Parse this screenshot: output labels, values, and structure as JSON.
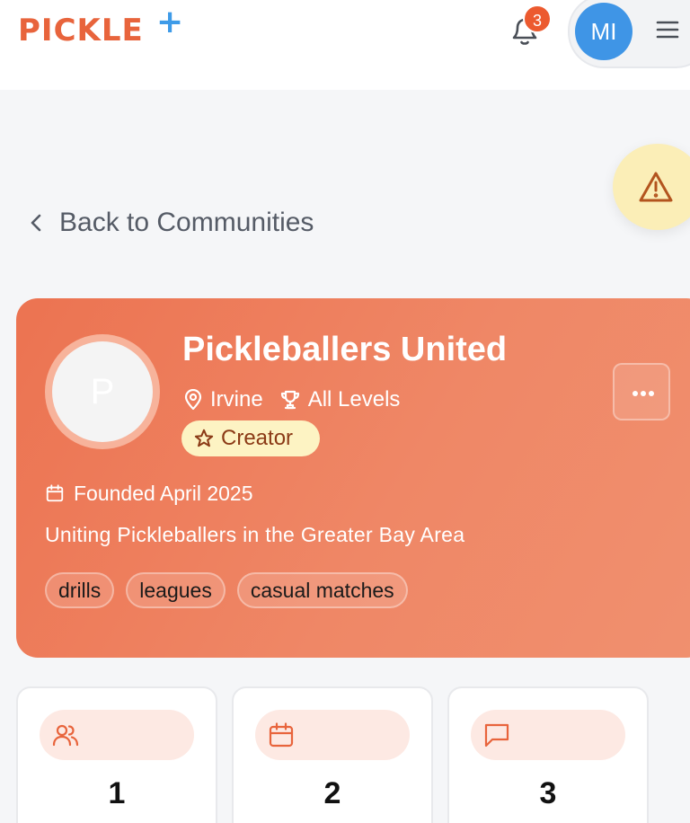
{
  "header": {
    "logo_text": "PICKLE",
    "logo_plus": "+",
    "notification_count": "3",
    "avatar_initials": "MI"
  },
  "nav": {
    "back_label": "Back to Communities"
  },
  "community": {
    "avatar_letter": "P",
    "name": "Pickleballers United",
    "location": "Irvine",
    "level": "All Levels",
    "role_badge": "Creator",
    "founded": "Founded April 2025",
    "description": "Uniting Pickleballers in the Greater Bay Area",
    "tags": [
      "drills",
      "leagues",
      "casual matches"
    ]
  },
  "stats": [
    {
      "icon": "users-icon",
      "value": "1"
    },
    {
      "icon": "calendar-icon",
      "value": "2"
    },
    {
      "icon": "message-icon",
      "value": "3"
    }
  ],
  "colors": {
    "brand_orange": "#e8643c",
    "brand_blue": "#3e9be8",
    "hero_gradient_start": "#ec7351",
    "hero_gradient_end": "#f0906f",
    "badge_yellow": "#fdf3c3",
    "warning_bg": "#fbeeb7"
  }
}
